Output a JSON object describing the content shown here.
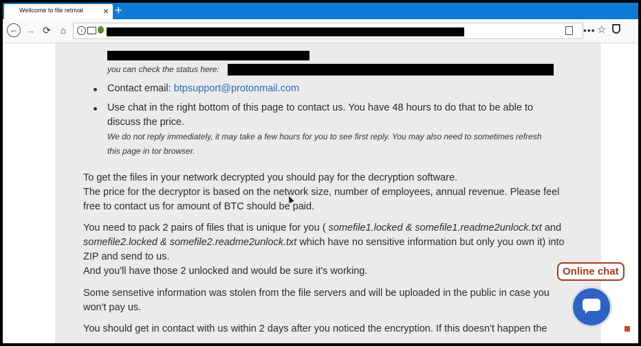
{
  "browser": {
    "tab_title": "Wellcome to file retrival",
    "tab_close": "×",
    "new_tab": "+",
    "back": "←",
    "forward": "→",
    "reload": "⟳",
    "home": "⌂",
    "info": "i",
    "menu": "•••",
    "star": "☆"
  },
  "content": {
    "status_line": "you can check the status here:",
    "contact_label": "Contact email:",
    "contact_email": "btpsupport@protonmail.com",
    "chat_line_1": "Use chat in the right bottom of this page to contact us. You have 48 hours to do that to be able to",
    "chat_line_2": "discuss the price.",
    "chat_note_1": "We do not reply immediately, it may take a few hours for you to see first reply. You may also need to sometimes refresh",
    "chat_note_2": "this page in tor browser.",
    "para1_line1": "To get the files in your network decrypted you should pay for the decryption software.",
    "para1_line2": "The price for the decryptor is based on the network size, number of employees, annual revenue. Please feel",
    "para1_line3": "free to contact us for amount of BTC should be paid.",
    "para2_line1_a": "You need to pack 2 pairs of files that is unique for you ( ",
    "para2_line1_b": "somefile1.locked & somefile1.readme2unlock.txt",
    "para2_line1_c": " and",
    "para2_line2_a": "somefile2.locked & somefile2.readme2unlock.txt",
    "para2_line2_b": " which have no sensitive information but only you own it) into",
    "para2_line3": "ZIP and send to us.",
    "para2_line4": "And you'll have those 2 unlocked and would be sure it's working.",
    "para3_line1": "Some sensetive information was stolen from the file servers and will be uploaded in the public in case you",
    "para3_line2": "won't pay us.",
    "para4_line1": "You should get in contact with us within 2 days after you noticed the encryption. If this doesn't happen the"
  },
  "chat": {
    "label": "Online chat"
  }
}
